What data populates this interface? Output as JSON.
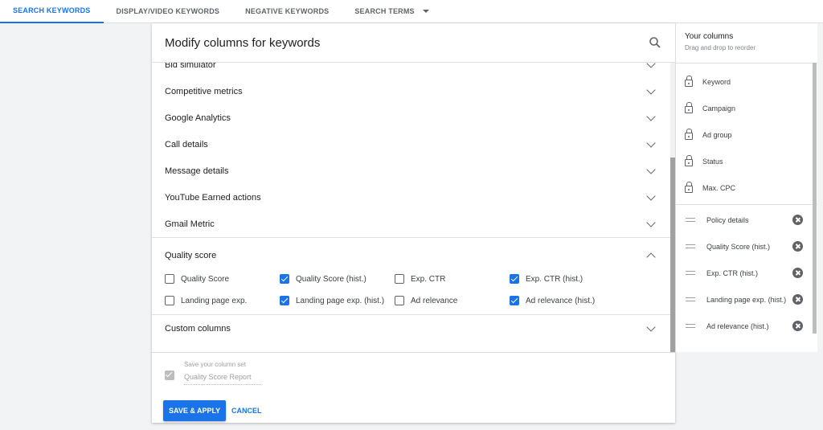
{
  "tabs": [
    {
      "label": "SEARCH KEYWORDS",
      "active": true
    },
    {
      "label": "DISPLAY/VIDEO KEYWORDS",
      "active": false
    },
    {
      "label": "NEGATIVE KEYWORDS",
      "active": false
    },
    {
      "label": "SEARCH TERMS",
      "active": false
    }
  ],
  "panel": {
    "title": "Modify columns for keywords",
    "search_icon": "search-icon",
    "sections": [
      "Bid simulator",
      "Competitive metrics",
      "Google Analytics",
      "Call details",
      "Message details",
      "YouTube Earned actions",
      "Gmail Metric"
    ],
    "quality_score": {
      "title": "Quality score",
      "options": [
        {
          "label": "Quality Score",
          "checked": false
        },
        {
          "label": "Quality Score (hist.)",
          "checked": true
        },
        {
          "label": "Exp. CTR",
          "checked": false
        },
        {
          "label": "Exp. CTR (hist.)",
          "checked": true
        },
        {
          "label": "Landing page exp.",
          "checked": false
        },
        {
          "label": "Landing page exp. (hist.)",
          "checked": true
        },
        {
          "label": "Ad relevance",
          "checked": false
        },
        {
          "label": "Ad relevance (hist.)",
          "checked": true
        }
      ]
    },
    "custom_columns": "Custom columns"
  },
  "footer": {
    "save_set_label": "Save your column set",
    "save_set_value": "Quality Score Report",
    "save_apply": "SAVE & APPLY",
    "cancel": "CANCEL"
  },
  "your_columns": {
    "title": "Your columns",
    "subtitle": "Drag and drop to reorder",
    "locked": [
      "Keyword",
      "Campaign",
      "Ad group",
      "Status",
      "Max. CPC"
    ],
    "movable": [
      "Policy details",
      "Quality Score (hist.)",
      "Exp. CTR (hist.)",
      "Landing page exp. (hist.)",
      "Ad relevance (hist.)"
    ]
  },
  "colors": {
    "accent": "#1a73e8",
    "text": "#202124"
  }
}
